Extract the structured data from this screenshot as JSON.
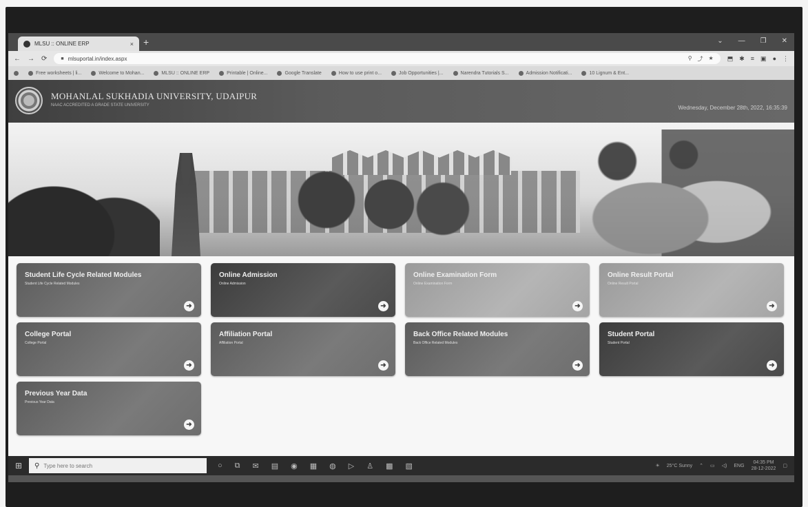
{
  "browser": {
    "tab_title": "MLSU :: ONLINE ERP",
    "tab_close": "×",
    "new_tab": "+",
    "url": "mlsuportal.in/index.aspx",
    "bookmarks": [
      "Free worksheets | li...",
      "Welcome to Mohan...",
      "MLSU :: ONLINE ERP",
      "Printable | Online...",
      "Google Translate",
      "How to use print o...",
      "Job Opportunities |...",
      "Narendra Tutorials S...",
      "Admission Notificati...",
      "10 Lignum & Ent..."
    ]
  },
  "site": {
    "university_name": "MOHANLAL SUKHADIA UNIVERSITY, UDAIPUR",
    "university_sub": "NAAC ACCREDITED A GRADE STATE UNIVERSITY",
    "datetime": "Wednesday, December 28th, 2022, 16:35:39"
  },
  "tiles": [
    {
      "title": "Student Life Cycle Related Modules",
      "sub": "Student Life Cycle Related Modules"
    },
    {
      "title": "Online Admission",
      "sub": "Online Admission"
    },
    {
      "title": "Online Examination Form",
      "sub": "Online Examination Form"
    },
    {
      "title": "Online Result Portal",
      "sub": "Online Result Portal"
    },
    {
      "title": "College Portal",
      "sub": "College Portal"
    },
    {
      "title": "Affiliation Portal",
      "sub": "Affiliation Portal"
    },
    {
      "title": "Back Office Related Modules",
      "sub": "Back Office Related Modules"
    },
    {
      "title": "Student Portal",
      "sub": "Student Portal"
    },
    {
      "title": "Previous Year Data",
      "sub": "Previous Year Data"
    }
  ],
  "taskbar": {
    "search_placeholder": "Type here to search",
    "weather": "25°C Sunny",
    "lang": "ENG",
    "time": "04:35 PM",
    "date": "28-12-2022"
  }
}
